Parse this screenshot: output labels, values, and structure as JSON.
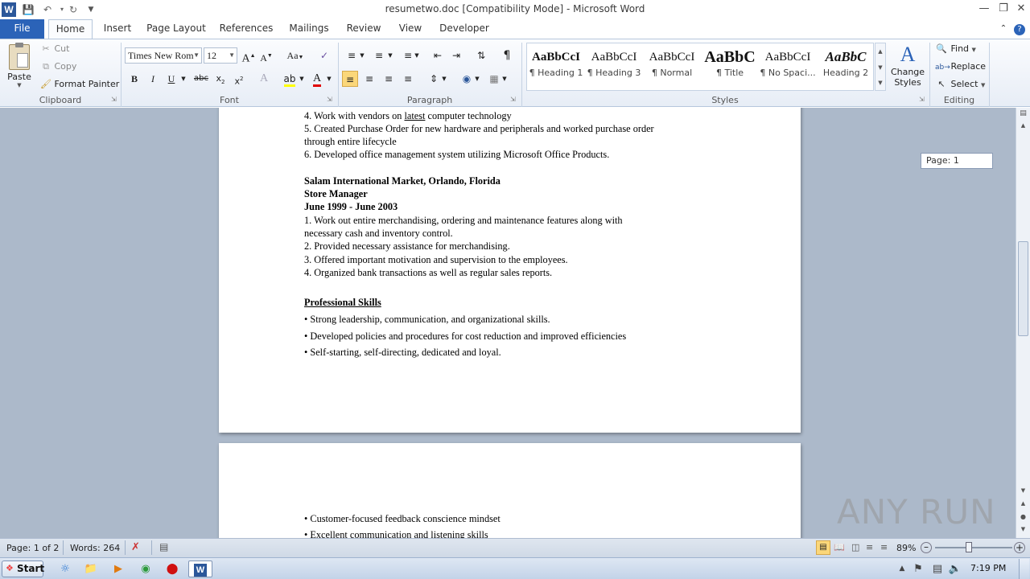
{
  "window": {
    "title": "resumetwo.doc [Compatibility Mode]  -  Microsoft Word"
  },
  "tabs": [
    "File",
    "Home",
    "Insert",
    "Page Layout",
    "References",
    "Mailings",
    "Review",
    "View",
    "Developer"
  ],
  "clipboard": {
    "paste": "Paste",
    "cut": "Cut",
    "copy": "Copy",
    "format_painter": "Format Painter",
    "label": "Clipboard"
  },
  "font": {
    "name": "Times New Rom",
    "size": "12",
    "label": "Font"
  },
  "paragraph": {
    "label": "Paragraph"
  },
  "styles": {
    "label": "Styles",
    "items": [
      {
        "preview": "AaBbCcI",
        "name": "¶ Heading 1"
      },
      {
        "preview": "AaBbCcI",
        "name": "¶ Heading 3"
      },
      {
        "preview": "AaBbCcI",
        "name": "¶ Normal"
      },
      {
        "preview": "AaBbC",
        "name": "¶ Title"
      },
      {
        "preview": "AaBbCcI",
        "name": "¶ No Spaci..."
      },
      {
        "preview": "AaBbC",
        "name": "Heading 2"
      }
    ],
    "change_styles": "Change Styles"
  },
  "editing": {
    "label": "Editing",
    "find": "Find",
    "replace": "Replace",
    "select": "Select"
  },
  "page_tooltip": "Page: 1",
  "document": {
    "page1_lines": [
      {
        "pre": "4. Work with vendors on ",
        "u": "latest",
        "post": " computer technology"
      },
      {
        "text": "5. Created Purchase Order for new hardware and peripherals  and worked purchase order"
      },
      {
        "text": "through entire lifecycle"
      },
      {
        "text": "6. Developed  office management system utilizing  Microsoft Office Products."
      }
    ],
    "employer": "Salam International Market, Orlando, Florida",
    "position": "Store Manager",
    "dates": "June 1999 - June 2003",
    "duties": [
      "1. Work out entire merchandising, ordering and maintenance features along with",
      "necessary cash and inventory  control.",
      "2. Provided necessary assistance for merchandising.",
      "3. Offered important motivation and supervision to the employees.",
      "4. Organized  bank transactions as well as regular  sales reports."
    ],
    "skills_heading": "Professional Skills",
    "skills": [
      "• Strong leadership,  communication, and organizational  skills.",
      "• Developed  policies  and procedures for cost reduction and improved  efficiencies",
      "• Self-starting, self-directing, dedicated and loyal."
    ],
    "page2_skills": [
      "• Customer-focused feedback conscience mindset",
      "• Excellent  communication and listening  skills"
    ]
  },
  "status": {
    "page": "Page: 1 of 2",
    "words": "Words: 264",
    "zoom": "89%"
  },
  "taskbar": {
    "start": "Start",
    "clock": "7:19 PM"
  },
  "watermark": "ANY RUN"
}
